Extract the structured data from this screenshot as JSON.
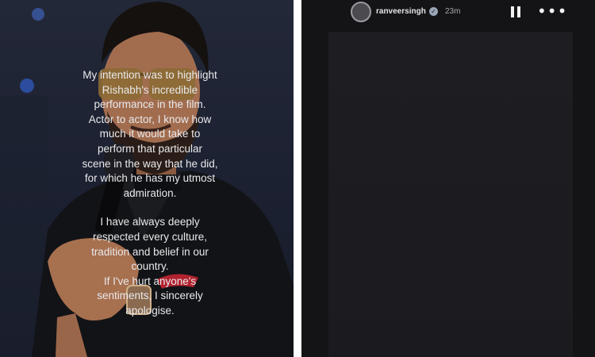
{
  "story": {
    "username": "ranveersingh",
    "timestamp": "23m",
    "verified_badge": "verified-icon",
    "pause_icon": "pause-icon",
    "more_icon": "more-icon",
    "message": {
      "paragraph1": [
        "My intention was to highlight",
        "Rishabh's incredible",
        "performance in the film.",
        "Actor to actor, I know how",
        "much it would take to",
        "perform that particular",
        "scene in the way that he did,",
        "for which he has my utmost",
        "admiration."
      ],
      "paragraph2": [
        "I have always deeply",
        "respected every culture,",
        "tradition and belief in our",
        "country.",
        "If I've hurt anyone's",
        "sentiments, I sincerely",
        "apologise."
      ]
    }
  },
  "colors": {
    "story_background": "#141416",
    "story_text": "#e9e9ec",
    "photo_background": "#1b2030"
  }
}
